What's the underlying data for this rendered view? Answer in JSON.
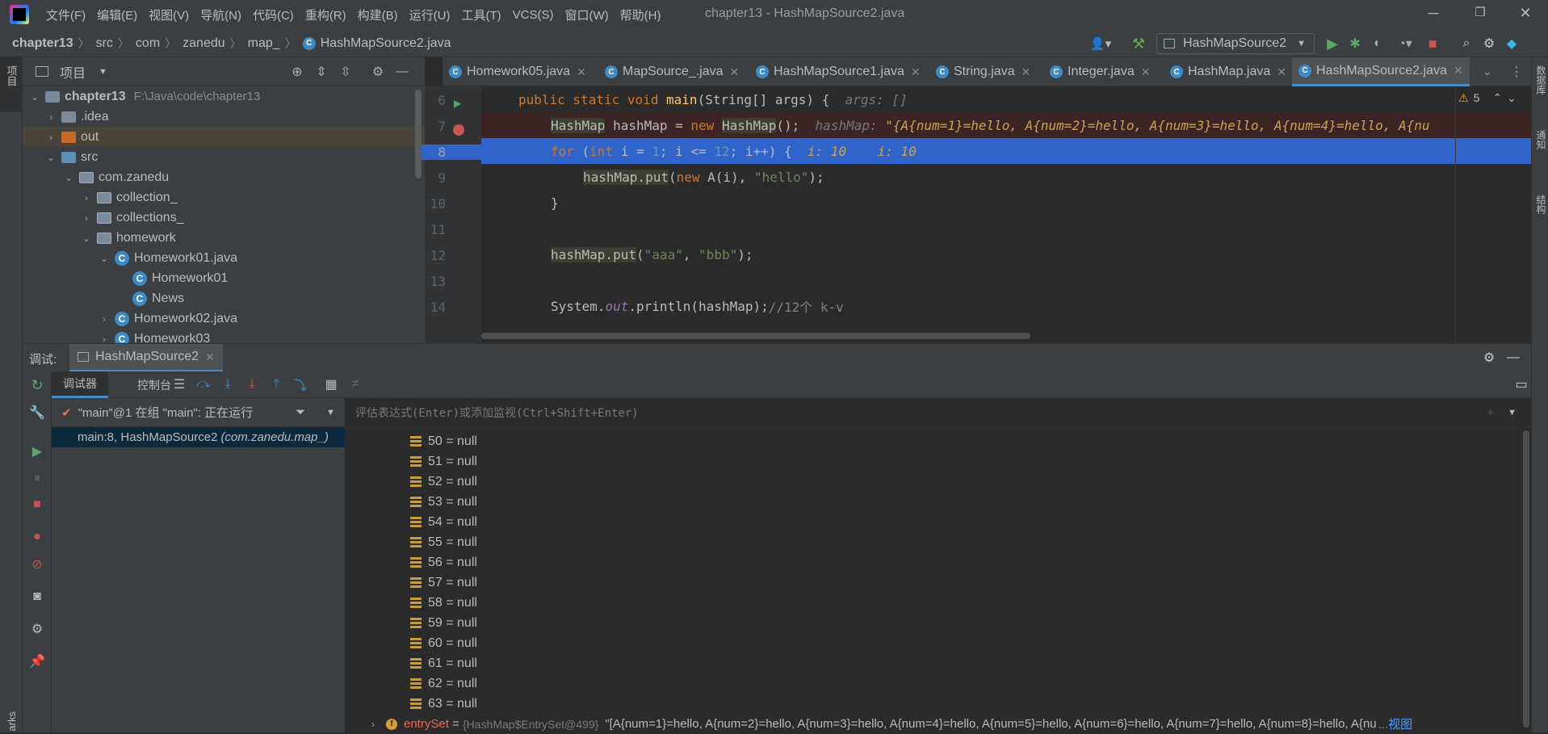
{
  "menu": {
    "items": [
      "文件(F)",
      "编辑(E)",
      "视图(V)",
      "导航(N)",
      "代码(C)",
      "重构(R)",
      "构建(B)",
      "运行(U)",
      "工具(T)",
      "VCS(S)",
      "窗口(W)",
      "帮助(H)"
    ],
    "window_title": "chapter13 - HashMapSource2.java"
  },
  "breadcrumb": [
    "chapter13",
    "src",
    "com",
    "zanedu",
    "map_",
    "HashMapSource2.java"
  ],
  "run_config": "HashMapSource2",
  "project": {
    "title": "项目",
    "root_label": "chapter13",
    "root_path": "F:\\Java\\code\\chapter13",
    "items": [
      {
        "label": ".idea"
      },
      {
        "label": "out"
      },
      {
        "label": "src"
      },
      {
        "label": "com.zanedu"
      },
      {
        "label": "collection_"
      },
      {
        "label": "collections_"
      },
      {
        "label": "homework"
      },
      {
        "label": "Homework01.java"
      },
      {
        "label": "Homework01"
      },
      {
        "label": "News"
      },
      {
        "label": "Homework02.java"
      },
      {
        "label": "Homework03"
      }
    ]
  },
  "tabs": [
    "Homework05.java",
    "MapSource_.java",
    "HashMapSource1.java",
    "String.java",
    "Integer.java",
    "HashMap.java",
    "HashMapSource2.java"
  ],
  "editor": {
    "warning_count": "5",
    "line_numbers": [
      "6",
      "7",
      "8",
      "9",
      "10",
      "11",
      "12",
      "13",
      "14"
    ]
  },
  "debug": {
    "label": "调试:",
    "session": "HashMapSource2",
    "tab_debugger": "调试器",
    "tab_console": "控制台",
    "thread": "\"main\"@1 在组 \"main\": 正在运行",
    "frame": "main:8, HashMapSource2",
    "frame_pkg": "(com.zanedu.map_)",
    "eval_placeholder": "评估表达式(Enter)或添加监视(Ctrl+Shift+Enter)",
    "vars": [
      "50 = null",
      "51 = null",
      "52 = null",
      "53 = null",
      "54 = null",
      "55 = null",
      "56 = null",
      "57 = null",
      "58 = null",
      "59 = null",
      "60 = null",
      "61 = null",
      "62 = null",
      "63 = null"
    ],
    "entryset_name": "entrySet",
    "entryset_eq": " = ",
    "entryset_ref": "{HashMap$EntrySet@499}",
    "entryset_val": "\"[A{num=1}=hello, A{num=2}=hello, A{num=3}=hello, A{num=4}=hello, A{num=5}=hello, A{num=6}=hello, A{num=7}=hello, A{num=8}=hello, A{nu",
    "entryset_view": "...视图"
  },
  "stripes": {
    "left_project": "项目",
    "left_bottom": "arks",
    "right_db": "数据库",
    "right_notify": "通知",
    "right_struct": "结构"
  },
  "colors": {
    "accent": "#4a88c7",
    "selection": "#2f65ca",
    "breakpoint_line": "#3a2323"
  }
}
